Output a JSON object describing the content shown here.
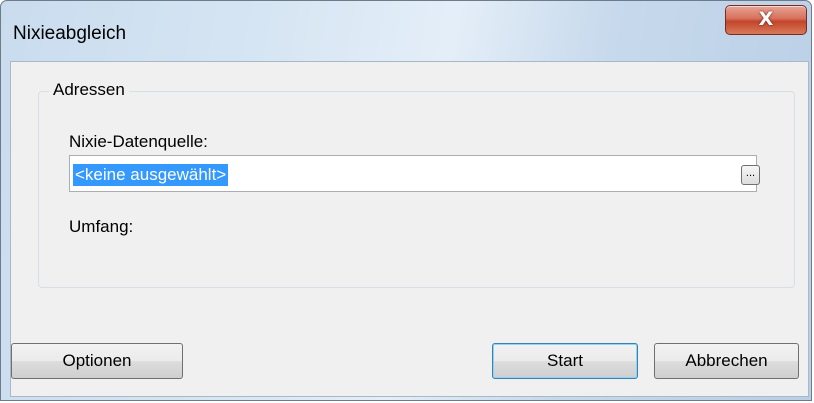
{
  "window": {
    "title": "Nixieabgleich",
    "close_symbol": "X"
  },
  "group": {
    "label": "Adressen"
  },
  "datasource": {
    "label": "Nixie-Datenquelle:",
    "value": "<keine ausgewählt>",
    "browse_label": "..."
  },
  "scope": {
    "label": "Umfang:"
  },
  "buttons": {
    "options": "Optionen",
    "start": "Start",
    "cancel": "Abbrechen"
  },
  "colors": {
    "selection": "#3399ff",
    "close_button": "#c2452b",
    "dialog_background": "#f0f0f0"
  }
}
